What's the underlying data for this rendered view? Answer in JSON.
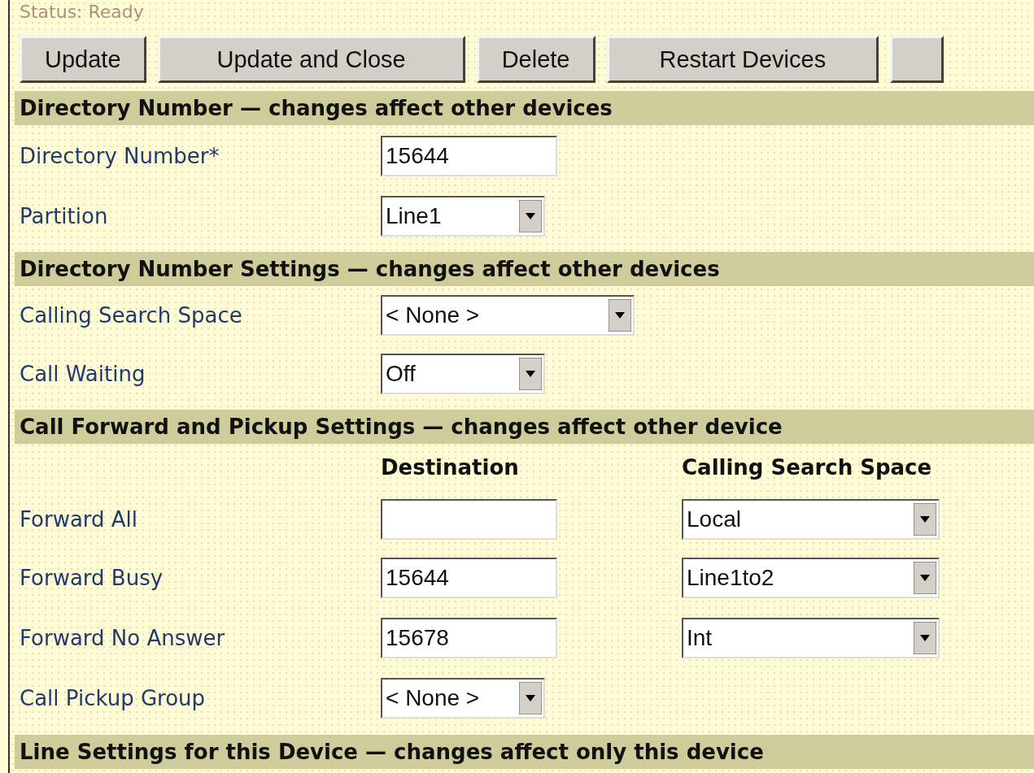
{
  "status": "Status: Ready",
  "buttons": [
    "Update",
    "Update and Close",
    "Delete",
    "Restart Devices"
  ],
  "sections": [
    {
      "kind": "fields",
      "title": "Directory Number — changes affect other devices",
      "rows": [
        {
          "label": "Directory Number*",
          "field": {
            "kind": "text",
            "value": "15644"
          }
        },
        {
          "label": "Partition",
          "field": {
            "kind": "select",
            "value": "Line1"
          }
        }
      ]
    },
    {
      "kind": "fields",
      "title": "Directory Number Settings — changes affect other devices",
      "rows": [
        {
          "label": "Calling Search Space",
          "field": {
            "kind": "select",
            "value": "< None >"
          }
        },
        {
          "label": "Call Waiting",
          "field": {
            "kind": "select",
            "value": "Off"
          }
        }
      ]
    },
    {
      "kind": "table",
      "title": "Call Forward and Pickup Settings — changes affect other device",
      "columns": [
        "Destination",
        "Calling Search Space"
      ],
      "rows": [
        {
          "label": "Forward All",
          "fields": [
            {
              "kind": "text"
            },
            {
              "kind": "select",
              "value": "Local"
            }
          ]
        },
        {
          "label": "Forward Busy",
          "fields": [
            {
              "kind": "text",
              "value": "15644"
            },
            {
              "kind": "select",
              "value": "Line1to2"
            }
          ]
        },
        {
          "label": "Forward No Answer",
          "fields": [
            {
              "kind": "text",
              "value": "15678"
            },
            {
              "kind": "select",
              "value": "Int"
            }
          ]
        },
        {
          "label": "Call Pickup Group",
          "fields": [
            {
              "kind": "select",
              "value": "< None >"
            }
          ]
        }
      ]
    },
    {
      "kind": "title",
      "title": "Line Settings for this Device — changes affect only this device"
    }
  ]
}
